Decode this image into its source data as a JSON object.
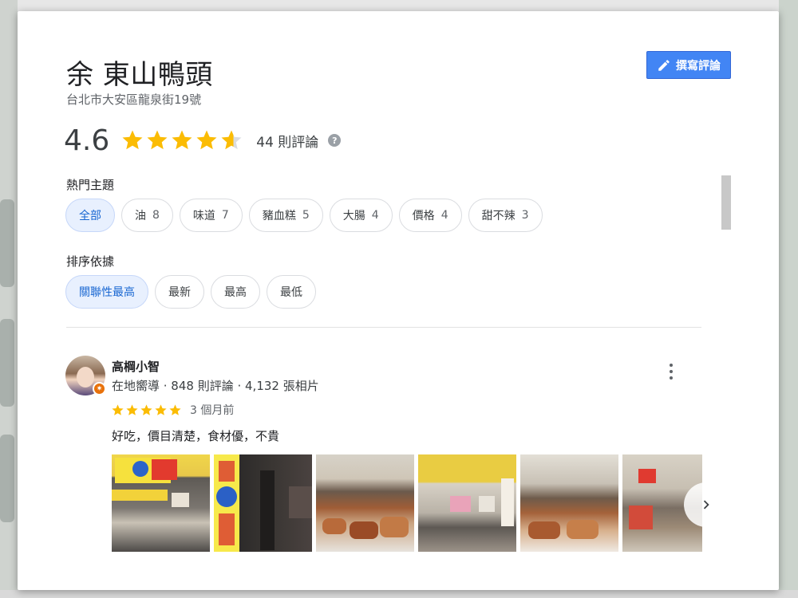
{
  "place": {
    "title": "余 東山鴨頭",
    "address": "台北市大安區龍泉街19號"
  },
  "write_review_label": "撰寫評論",
  "rating": {
    "value": "4.6",
    "stars_value": 4.6,
    "review_count_label": "44 則評論",
    "help_icon": "?"
  },
  "topics": {
    "label": "熱門主題",
    "chips": [
      {
        "label": "全部",
        "count": "",
        "selected": true
      },
      {
        "label": "油",
        "count": "8",
        "selected": false
      },
      {
        "label": "味道",
        "count": "7",
        "selected": false
      },
      {
        "label": "豬血糕",
        "count": "5",
        "selected": false
      },
      {
        "label": "大腸",
        "count": "4",
        "selected": false
      },
      {
        "label": "價格",
        "count": "4",
        "selected": false
      },
      {
        "label": "甜不辣",
        "count": "3",
        "selected": false
      }
    ]
  },
  "sort": {
    "label": "排序依據",
    "chips": [
      {
        "label": "關聯性最高",
        "selected": true
      },
      {
        "label": "最新",
        "selected": false
      },
      {
        "label": "最高",
        "selected": false
      },
      {
        "label": "最低",
        "selected": false
      }
    ]
  },
  "review": {
    "name": "高棡小智",
    "meta": "在地嚮導 · 848 則評論 · 4,132 張相片",
    "stars": 5,
    "time": "3 個月前",
    "text": "好吃，價目清楚，食材優，不貴",
    "photo_count_visible": 6
  },
  "colors": {
    "accent": "#4285f4",
    "star": "#fbbc04",
    "star_empty": "#dadce0",
    "chip_active_bg": "#e8f0fe",
    "chip_active_text": "#1967d2",
    "badge": "#e8710a"
  }
}
